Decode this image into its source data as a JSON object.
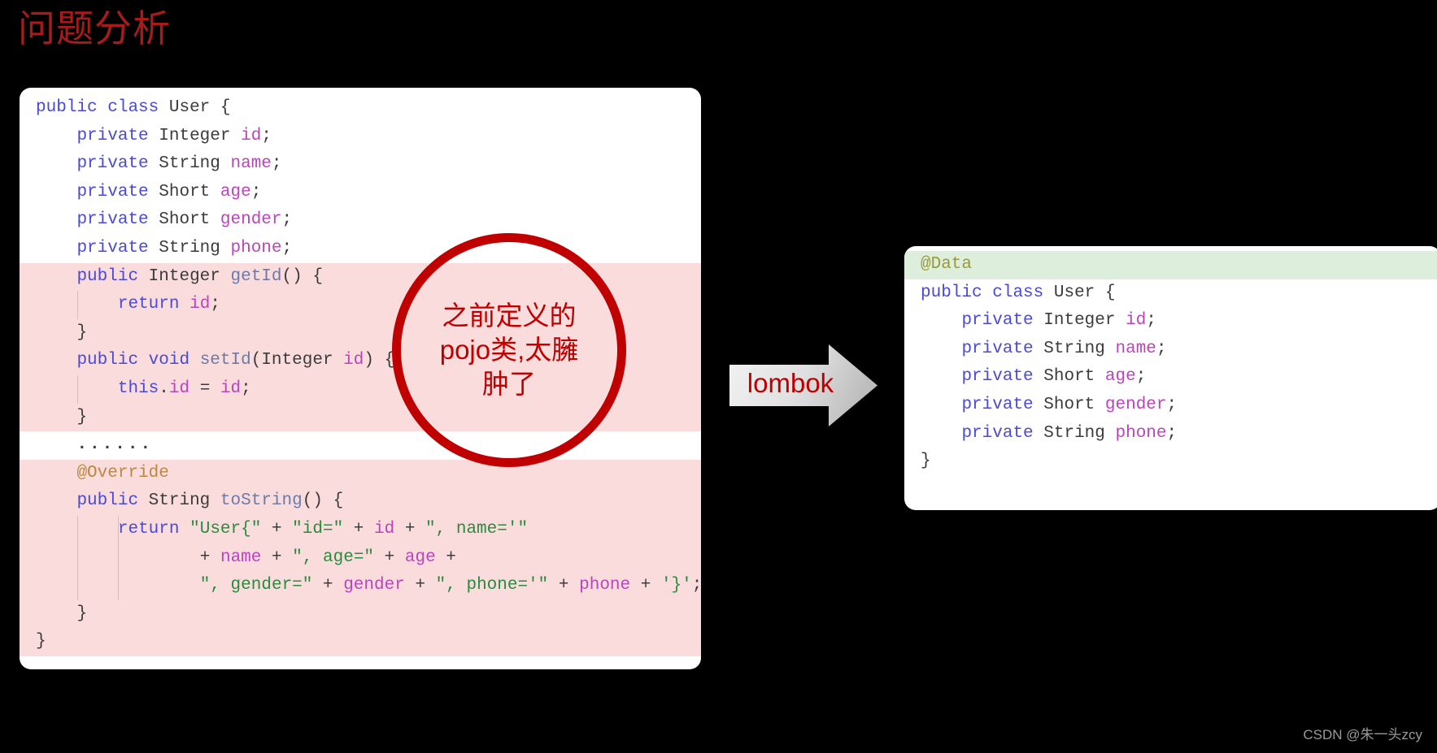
{
  "page": {
    "title": "问题分析",
    "title_color": "#a61b1b",
    "background_color": "#000000",
    "watermark": "CSDN @朱一头zcy"
  },
  "annotation": {
    "text": "之前定义的\npojo类,太臃\n肿了",
    "color": "#c00000",
    "shape": "circle"
  },
  "arrow": {
    "label": "lombok",
    "label_color": "#c00000",
    "fill_start": "#efefef",
    "fill_end": "#c8c8c8"
  },
  "left_panel": {
    "name": "verbose-pojo-code",
    "background": "#ffffff",
    "highlight_color": "#fadcdc",
    "lines": [
      {
        "text": "public class User {",
        "highlight": false,
        "indent": 0
      },
      {
        "text": "    private Integer id;",
        "highlight": false,
        "indent": 1
      },
      {
        "text": "    private String name;",
        "highlight": false,
        "indent": 1
      },
      {
        "text": "    private Short age;",
        "highlight": false,
        "indent": 1
      },
      {
        "text": "    private Short gender;",
        "highlight": false,
        "indent": 1
      },
      {
        "text": "    private String phone;",
        "highlight": false,
        "indent": 1
      },
      {
        "text": "    public Integer getId() {",
        "highlight": true,
        "indent": 1
      },
      {
        "text": "        return id;",
        "highlight": true,
        "indent": 2
      },
      {
        "text": "    }",
        "highlight": true,
        "indent": 1
      },
      {
        "text": "    public void setId(Integer id) {",
        "highlight": true,
        "indent": 1
      },
      {
        "text": "        this.id = id;",
        "highlight": true,
        "indent": 2
      },
      {
        "text": "    }",
        "highlight": true,
        "indent": 1
      },
      {
        "text": "    ......",
        "highlight": false,
        "indent": 1
      },
      {
        "text": "    @Override",
        "highlight": true,
        "indent": 1
      },
      {
        "text": "    public String toString() {",
        "highlight": true,
        "indent": 1
      },
      {
        "text": "        return \"User{\" + \"id=\" + id + \", name='\"",
        "highlight": true,
        "indent": 2
      },
      {
        "text": "                + name + \", age=\" + age +",
        "highlight": true,
        "indent": 2
      },
      {
        "text": "                \", gender=\" + gender + \", phone='\" + phone + '}';",
        "highlight": true,
        "indent": 2
      },
      {
        "text": "    }",
        "highlight": true,
        "indent": 1
      },
      {
        "text": "}",
        "highlight": true,
        "indent": 0
      }
    ]
  },
  "right_panel": {
    "name": "lombok-pojo-code",
    "background": "#ffffff",
    "highlight_color": "#ddeedd",
    "lines": [
      {
        "text": "@Data",
        "highlight": true,
        "indent": 0
      },
      {
        "text": "public class User {",
        "highlight": false,
        "indent": 0
      },
      {
        "text": "    private Integer id;",
        "highlight": false,
        "indent": 1
      },
      {
        "text": "    private String name;",
        "highlight": false,
        "indent": 1
      },
      {
        "text": "    private Short age;",
        "highlight": false,
        "indent": 1
      },
      {
        "text": "    private Short gender;",
        "highlight": false,
        "indent": 1
      },
      {
        "text": "    private String phone;",
        "highlight": false,
        "indent": 1
      },
      {
        "text": "}",
        "highlight": false,
        "indent": 0
      }
    ]
  },
  "syntax_colors": {
    "keyword": "#4a4ad6",
    "type": "#3b3b3b",
    "variable": "#bb44bb",
    "method": "#6b7ba8",
    "string": "#2a8a3e",
    "annotation_override": "#bb8844",
    "annotation_data": "#9a9a33"
  }
}
